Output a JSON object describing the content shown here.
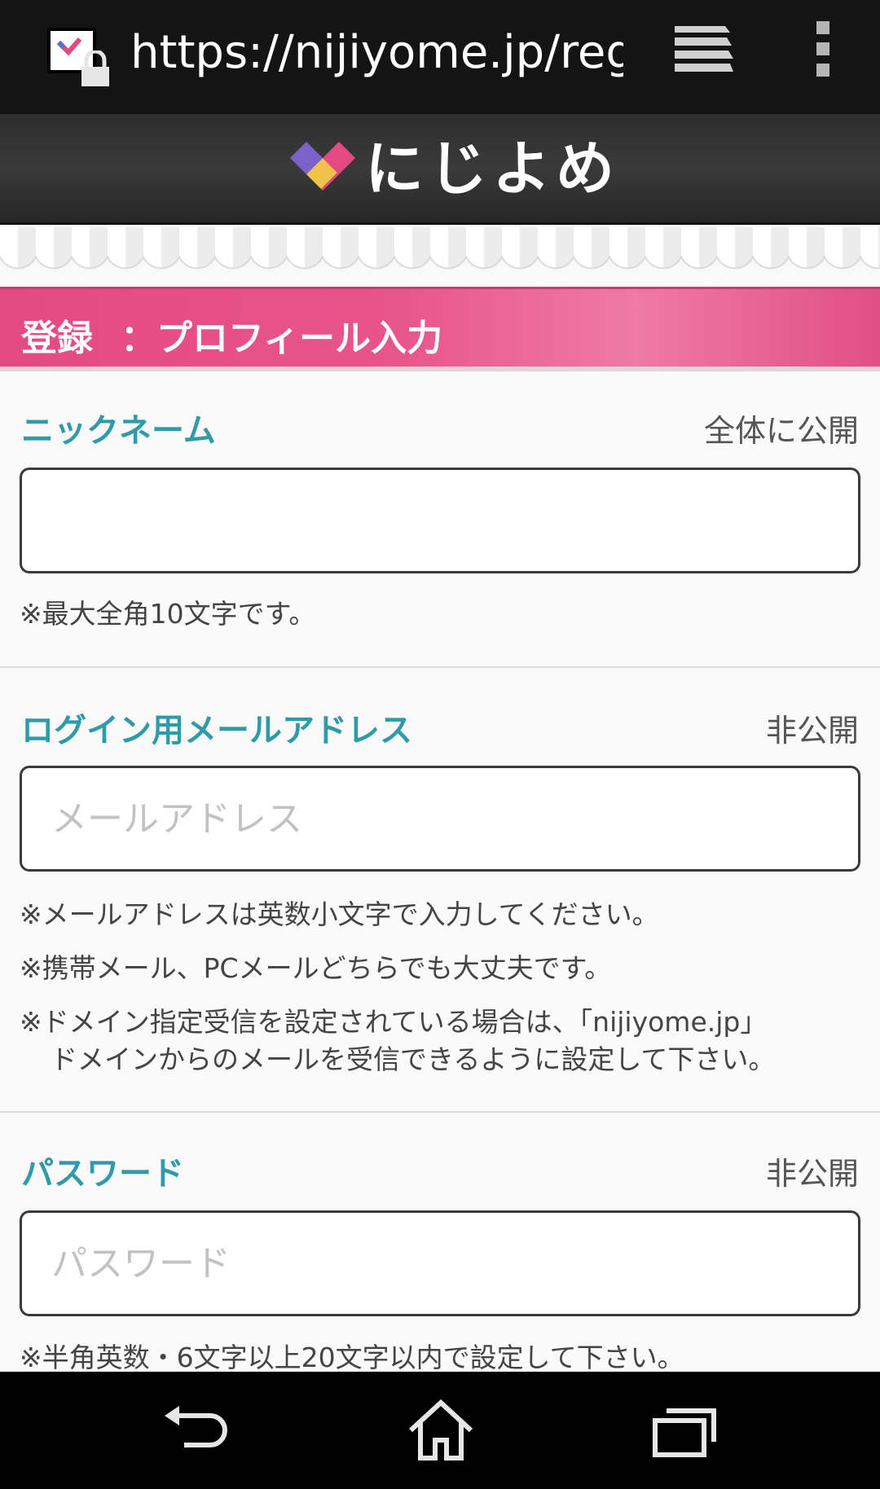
{
  "browser": {
    "url": "https://nijiyome.jp/registe",
    "tabs_icon": "tabs-icon",
    "menu_icon": "overflow-menu-icon"
  },
  "header": {
    "logo_icon": "heart-logo-icon",
    "logo_text": "にじよめ"
  },
  "title_bar": {
    "prefix": "登録",
    "title": "：プロフィール入力"
  },
  "nickname": {
    "label": "ニックネーム",
    "visibility": "全体に公開",
    "value": "",
    "note": "※最大全角10文字です。"
  },
  "email": {
    "label": "ログイン用メールアドレス",
    "visibility": "非公開",
    "placeholder": "メールアドレス",
    "notes": [
      "※メールアドレスは英数小文字で入力してください。",
      "※携帯メール、PCメールどちらでも大丈夫です。",
      "※ドメイン指定受信を設定されている場合は、「nijiyome.jp」",
      "ドメインからのメールを受信できるように設定して下さい。"
    ]
  },
  "password": {
    "label": "パスワード",
    "visibility": "非公開",
    "placeholder": "パスワード",
    "note": "※半角英数・6文字以上20文字以内で設定して下さい。"
  },
  "navbar": {
    "back_icon": "back-icon",
    "home_icon": "home-icon",
    "recents_icon": "recents-icon"
  },
  "colors": {
    "accent_pink": "#e44a82",
    "label_teal": "#2f9aa8",
    "header_dark": "#2e2e2e"
  }
}
